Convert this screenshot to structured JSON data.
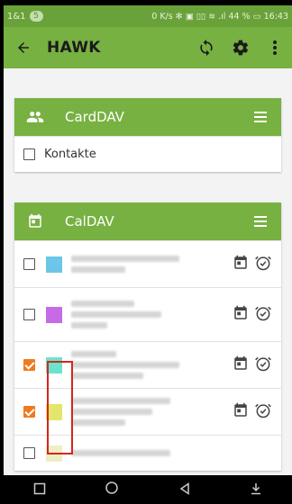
{
  "status_bar": {
    "carrier": "1&1",
    "badge": "5",
    "right_text": "0 K/s ✻ ▣ ▯▯ ≋ .ıl 44 % ▭ 16:43"
  },
  "toolbar": {
    "title": "HAWK",
    "icons": [
      "back-arrow-icon",
      "sync-icon",
      "gear-icon",
      "overflow-menu-icon"
    ]
  },
  "carddav": {
    "title": "CardDAV",
    "items": [
      {
        "label": "Kontakte",
        "checked": false
      }
    ]
  },
  "caldav": {
    "title": "CalDAV",
    "items": [
      {
        "color": "#6cc6e7",
        "checked": false
      },
      {
        "color": "#c56be6",
        "checked": false
      },
      {
        "color": "#6de3cf",
        "checked": true
      },
      {
        "color": "#e3e66b",
        "checked": true
      },
      {
        "color": "#eef0c4",
        "checked": false
      }
    ]
  },
  "colors": {
    "primary": "#77b142",
    "status": "#6aa23a",
    "accent": "#f07a1e",
    "highlight": "#d9241e"
  }
}
